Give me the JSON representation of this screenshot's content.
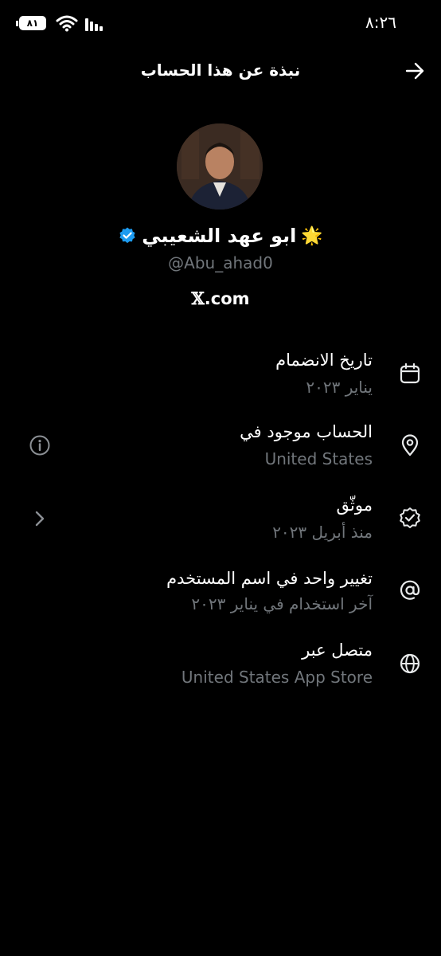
{
  "status_bar": {
    "time": "٨:٢٦",
    "battery": "٨١"
  },
  "header": {
    "title": "نبذة عن هذا الحساب"
  },
  "profile": {
    "name": "ابو عهد الشعيبي",
    "emoji": "🌟",
    "handle": "@Abu_ahad0",
    "site_prefix": "𝕏",
    "site_suffix": ".com"
  },
  "rows": [
    {
      "icon": "calendar-icon",
      "title": "تاريخ الانضمام",
      "subtitle": "يناير ٢٠٢٣"
    },
    {
      "icon": "location-pin-icon",
      "title": "الحساب موجود في",
      "subtitle": "United States",
      "side_icon": "info-icon"
    },
    {
      "icon": "verified-badge-icon",
      "title": "موثّق",
      "subtitle": "منذ أبريل ٢٠٢٣",
      "side_icon": "chevron-right-icon"
    },
    {
      "icon": "at-sign-icon",
      "title": "تغيير واحد في اسم المستخدم",
      "subtitle": "آخر استخدام في يناير ٢٠٢٣"
    },
    {
      "icon": "globe-icon",
      "title": "متصل عبر",
      "subtitle": "United States App Store"
    }
  ],
  "colors": {
    "background": "#000000",
    "text": "#e7e9ea",
    "muted": "#71767b",
    "verified": "#1d9bf0"
  }
}
